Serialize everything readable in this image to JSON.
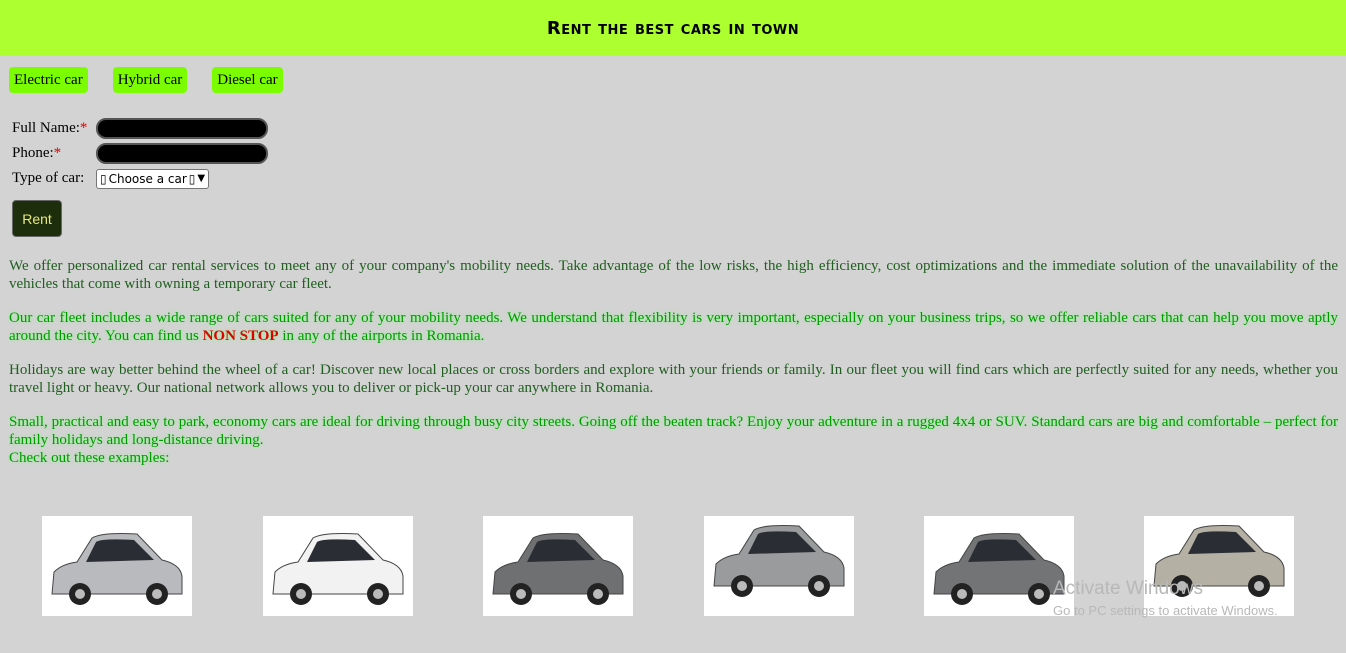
{
  "header": {
    "title": "Rent the best cars in town"
  },
  "tabs": [
    "Electric car",
    "Hybrid car",
    "Diesel car"
  ],
  "form": {
    "full_name_label": "Full Name:",
    "phone_label": "Phone:",
    "type_label": "Type of car:",
    "required_mark": "*",
    "select_value": "Choose a car",
    "rent_label": "Rent"
  },
  "paragraphs": {
    "p1": "We offer personalized car rental services to meet any of your company's mobility needs. Take advantage of the low risks, the high efficiency, cost optimizations and the immediate solution of the unavailability of the vehicles that come with owning a temporary car fleet.",
    "p2a": "Our car fleet includes a wide range of cars suited for any of your mobility needs. We understand that flexibility is very important, especially on your business trips, so we offer reliable cars that can help you move aptly around the city. You can find us ",
    "p2b": "NON STOP",
    "p2c": " in any of the airports in Romania.",
    "p3": "Holidays are way better behind the wheel of a car! Discover new local places or cross borders and explore with your friends or family. In our fleet you will find cars which are perfectly suited for any needs, whether you travel light or heavy. Our national network allows you to deliver or pick-up your car anywhere in Romania.",
    "p4": "Small, practical and easy to park, economy cars are ideal for driving through busy city streets. Going off the beaten track? Enjoy your adventure in a rugged 4x4 or SUV. Standard cars are big and comfortable – perfect for family holidays and long-distance driving.",
    "p5": "Check out these examples:"
  },
  "cars": [
    {
      "name": "silver-hatchback",
      "color": "#b8babd"
    },
    {
      "name": "white-sedan",
      "color": "#f2f2f2"
    },
    {
      "name": "grey-hatchback",
      "color": "#6f7072"
    },
    {
      "name": "silver-suv",
      "color": "#9a9b9d"
    },
    {
      "name": "grey-compact",
      "color": "#727476"
    },
    {
      "name": "beige-city-car",
      "color": "#b4b0a4"
    }
  ],
  "watermark": {
    "line1": "Activate Windows",
    "line2": "Go to PC settings to activate Windows."
  }
}
